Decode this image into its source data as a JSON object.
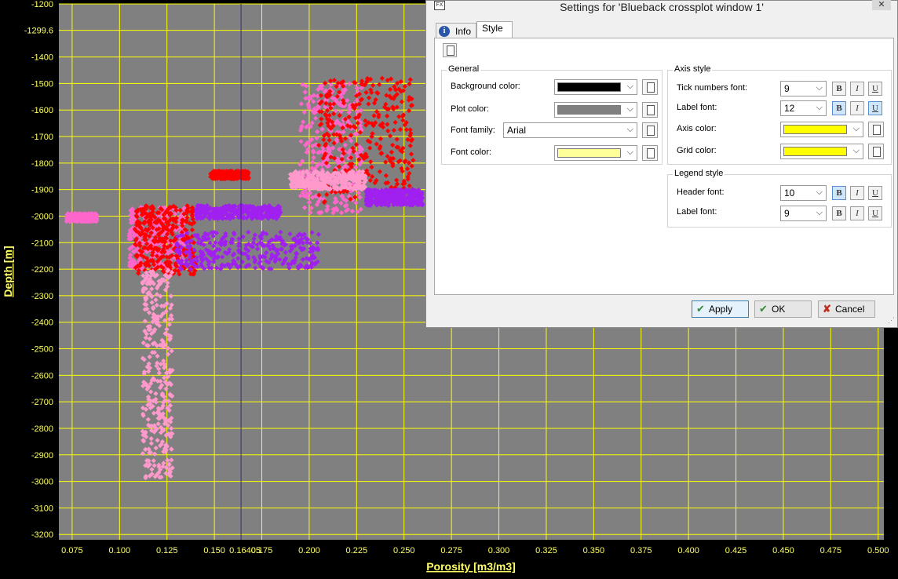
{
  "chart_data": {
    "type": "scatter",
    "xlabel": "Porosity [m3/m3]",
    "ylabel": "Depth [m]",
    "xlim": [
      0.068,
      0.503
    ],
    "ylim": [
      -3220,
      -1200
    ],
    "x_ticks": [
      "0.075",
      "0.100",
      "0.125",
      "0.150",
      "0.175",
      "0.200",
      "0.225",
      "0.250",
      "0.275",
      "0.300",
      "0.325",
      "0.350",
      "0.375",
      "0.400",
      "0.425",
      "0.450",
      "0.475",
      "0.500"
    ],
    "y_ticks": [
      "-1200",
      "-1299.6",
      "-1400",
      "-1500",
      "-1600",
      "-1700",
      "-1800",
      "-1900",
      "-2000",
      "-2100",
      "-2200",
      "-2300",
      "-2400",
      "-2500",
      "-2600",
      "-2700",
      "-2800",
      "-2900",
      "-3000",
      "-3100",
      "-3200"
    ],
    "cursor": {
      "x": 0.16405,
      "y": -1299.6,
      "x_label": "0.16405"
    },
    "background_color": "#000000",
    "plot_color": "#808080",
    "axis_color": "#ffff00",
    "grid": true,
    "series": [
      {
        "color": "#ff66cc",
        "clusters": [
          {
            "x": [
              0.195,
              0.228
            ],
            "y": [
              -1990,
              -1500
            ]
          },
          {
            "x": [
              0.105,
              0.135
            ],
            "y": [
              -2200,
              -1960
            ]
          },
          {
            "x": [
              0.072,
              0.088
            ],
            "y": [
              -2020,
              -1990
            ]
          }
        ]
      },
      {
        "color": "#ff0000",
        "clusters": [
          {
            "x": [
              0.205,
              0.255
            ],
            "y": [
              -1950,
              -1480
            ]
          },
          {
            "x": [
              0.108,
              0.14
            ],
            "y": [
              -2220,
              -1960
            ]
          },
          {
            "x": [
              0.148,
              0.168
            ],
            "y": [
              -1860,
              -1830
            ]
          }
        ]
      },
      {
        "color": "#a020f0",
        "clusters": [
          {
            "x": [
              0.13,
              0.205
            ],
            "y": [
              -2200,
              -2060
            ]
          },
          {
            "x": [
              0.14,
              0.185
            ],
            "y": [
              -2010,
              -1960
            ]
          },
          {
            "x": [
              0.23,
              0.26
            ],
            "y": [
              -1960,
              -1900
            ]
          }
        ]
      },
      {
        "color": "#ff99cc",
        "clusters": [
          {
            "x": [
              0.112,
              0.128
            ],
            "y": [
              -2990,
              -2200
            ]
          },
          {
            "x": [
              0.19,
              0.23
            ],
            "y": [
              -1900,
              -1830
            ]
          }
        ]
      }
    ]
  },
  "dialog": {
    "title": "Settings for 'Blueback crossplot window 1'",
    "close_glyph": "✕",
    "app_icon": "FX",
    "tabs": {
      "info": "Info",
      "style": "Style"
    },
    "general": {
      "title": "General",
      "background_color_label": "Background color:",
      "background_color": "#000000",
      "plot_color_label": "Plot color:",
      "plot_color": "#808080",
      "font_family_label": "Font family:",
      "font_family": "Arial",
      "font_color_label": "Font color:",
      "font_color": "#ffff99"
    },
    "axis_style": {
      "title": "Axis style",
      "tick_numbers_font_label": "Tick numbers font:",
      "tick_numbers_font_size": "9",
      "label_font_label": "Label font:",
      "label_font_size": "12",
      "axis_color_label": "Axis color:",
      "axis_color": "#ffff00",
      "grid_color_label": "Grid color:",
      "grid_color": "#ffff00"
    },
    "legend_style": {
      "title": "Legend style",
      "header_font_label": "Header font:",
      "header_font_size": "10",
      "label_font_label": "Label font:",
      "label_font_size": "9"
    },
    "format_buttons": {
      "bold": "B",
      "italic": "I",
      "underline": "U"
    },
    "buttons": {
      "apply": "Apply",
      "ok": "OK",
      "cancel": "Cancel"
    }
  }
}
